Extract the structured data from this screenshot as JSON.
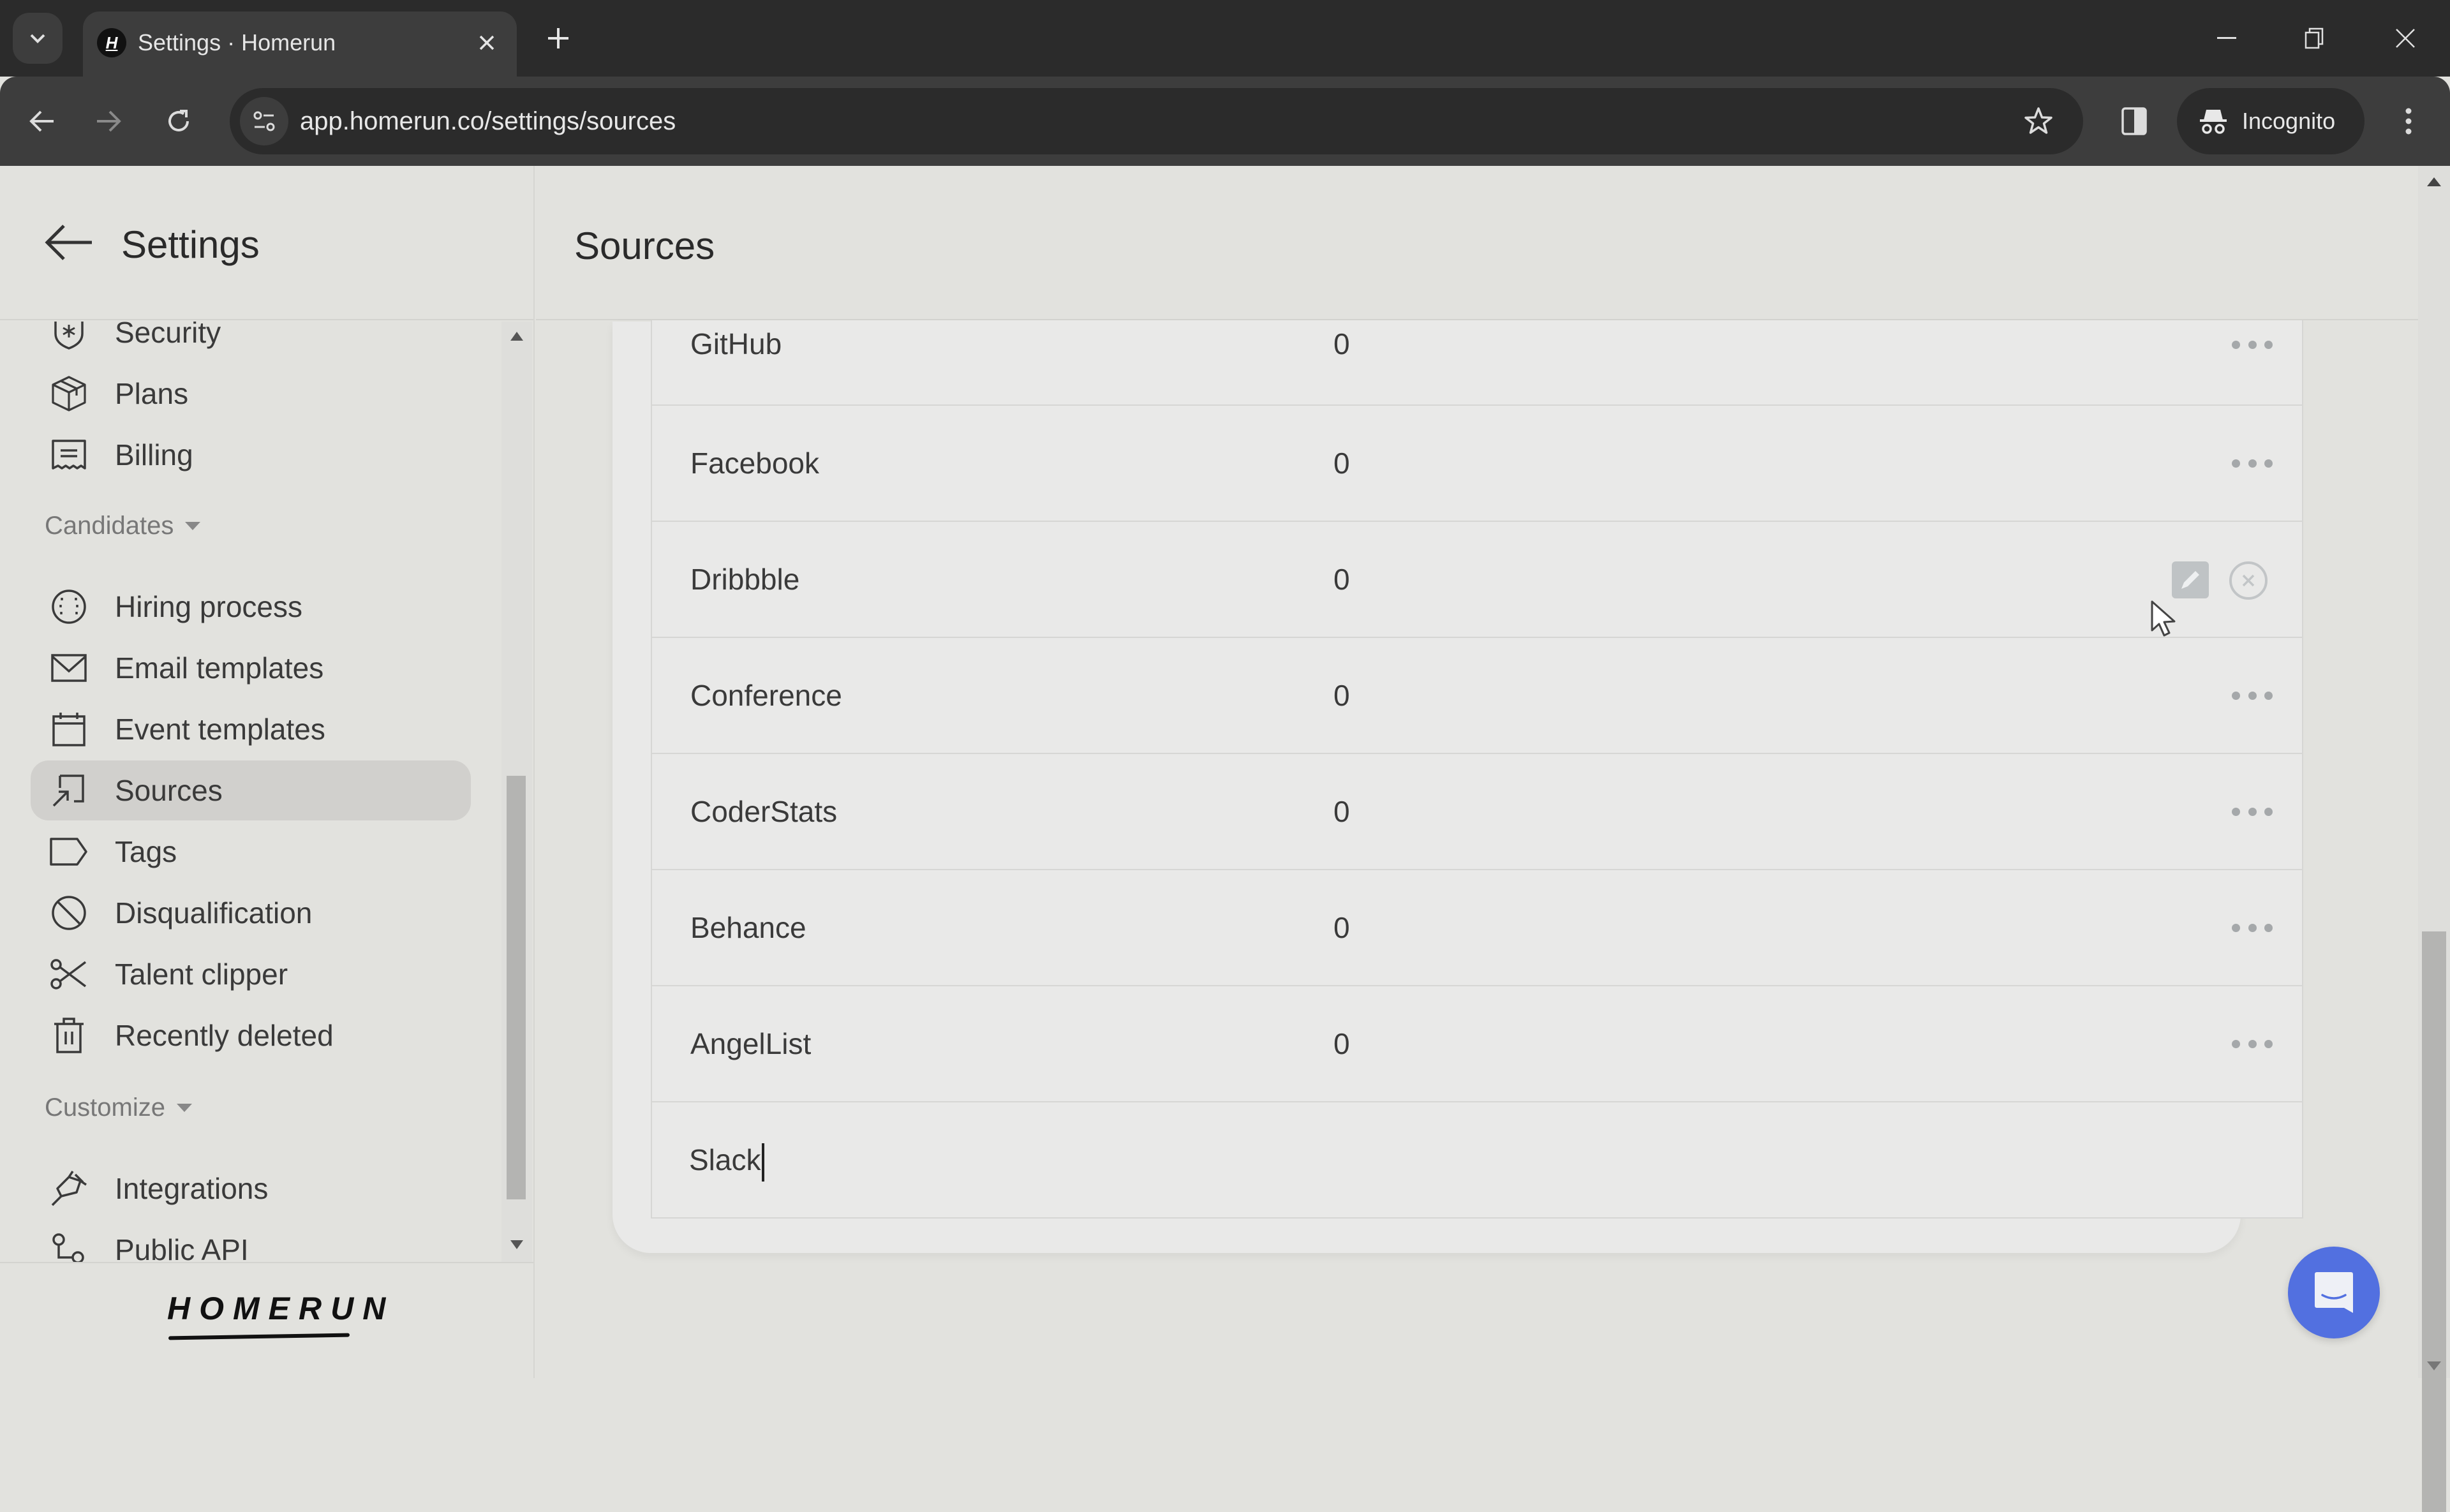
{
  "browser": {
    "tab_title": "Settings · Homerun",
    "favicon_letter": "H",
    "url": "app.homerun.co/settings/sources",
    "profile_label": "Incognito",
    "icons": [
      "tab-search-icon",
      "close-icon",
      "new-tab-icon",
      "minimize-icon",
      "restore-icon",
      "window-close-icon",
      "back-icon",
      "forward-icon",
      "reload-icon",
      "site-info-icon",
      "bookmark-star-icon",
      "side-panel-icon",
      "incognito-icon",
      "menu-icon"
    ]
  },
  "sidebar": {
    "title": "Settings",
    "sections": [
      {
        "label": null,
        "items": [
          {
            "label": "Security",
            "icon": "shield-icon"
          },
          {
            "label": "Plans",
            "icon": "box-icon"
          },
          {
            "label": "Billing",
            "icon": "receipt-icon"
          }
        ]
      },
      {
        "label": "Candidates",
        "items": [
          {
            "label": "Hiring process",
            "icon": "baseball-icon"
          },
          {
            "label": "Email templates",
            "icon": "envelope-icon"
          },
          {
            "label": "Event templates",
            "icon": "calendar-icon"
          },
          {
            "label": "Sources",
            "icon": "source-arrow-icon",
            "active": true
          },
          {
            "label": "Tags",
            "icon": "tag-icon"
          },
          {
            "label": "Disqualification",
            "icon": "ban-icon"
          },
          {
            "label": "Talent clipper",
            "icon": "scissors-icon"
          },
          {
            "label": "Recently deleted",
            "icon": "trash-icon"
          }
        ]
      },
      {
        "label": "Customize",
        "items": [
          {
            "label": "Integrations",
            "icon": "plug-icon"
          },
          {
            "label": "Public API",
            "icon": "api-icon"
          }
        ]
      }
    ],
    "logo": "HOMERUN"
  },
  "main": {
    "title": "Sources",
    "rows": [
      {
        "name": "GitHub",
        "count": "0",
        "actions": "more"
      },
      {
        "name": "Facebook",
        "count": "0",
        "actions": "more"
      },
      {
        "name": "Dribbble",
        "count": "0",
        "actions": "edit-delete"
      },
      {
        "name": "Conference",
        "count": "0",
        "actions": "more"
      },
      {
        "name": "CoderStats",
        "count": "0",
        "actions": "more"
      },
      {
        "name": "Behance",
        "count": "0",
        "actions": "more"
      },
      {
        "name": "AngelList",
        "count": "0",
        "actions": "more"
      }
    ],
    "new_source_input": {
      "value": "Slack"
    }
  },
  "colors": {
    "chat_button": "#5270e0",
    "active_item_bg": "#d1d0cd",
    "page_bg": "#e2e2de"
  }
}
